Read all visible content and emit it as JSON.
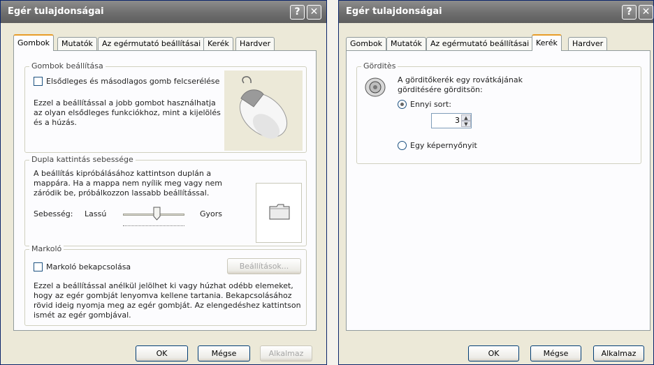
{
  "left": {
    "title": "Egér tulajdonságai",
    "help_glyph": "?",
    "close_glyph": "✕",
    "tabs": [
      "Gombok",
      "Mutatók",
      "Az egérmutató beállításai",
      "Kerék",
      "Hardver"
    ],
    "active_tab": "Gombok",
    "buttons_group": {
      "label": "Gombok beállítása",
      "swap_checkbox_label": "Elsődleges és másodlagos gomb felcserélése",
      "description": [
        "Ezzel a beállítással a jobb gombot használhatja",
        "az olyan elsődleges funkciókhoz, mint a kijelölés",
        "és a húzás."
      ]
    },
    "dblclick_group": {
      "label": "Dupla kattintás sebessége",
      "description": [
        "A beállítás kipróbálásához kattintson duplán a",
        "mappára. Ha a mappa nem nyílik meg vagy nem",
        "záródik be, próbálkozzon lassabb beállítással."
      ],
      "speed_label": "Sebesség:",
      "slow_label": "Lassú",
      "fast_label": "Gyors",
      "slider_value_fraction": 0.55
    },
    "clicklock_group": {
      "label": "Markoló",
      "checkbox_label": "Markoló bekapcsolása",
      "settings_button": "Beállítások...",
      "description": [
        "Ezzel a beállítással anélkül jelölhet ki vagy húzhat odébb elemeket,",
        "hogy az egér gombját lenyomva kellene tartania.  Bekapcsolásához",
        "rövid ideig nyomja meg az egér gombját.  Az elengedéshez kattintson",
        "ismét az egér gombjával."
      ]
    },
    "footer": {
      "ok": "OK",
      "cancel": "Mégse",
      "apply": "Alkalmaz"
    }
  },
  "right": {
    "title": "Egér tulajdonságai",
    "help_glyph": "?",
    "close_glyph": "✕",
    "tabs": [
      "Gombok",
      "Mutatók",
      "Az egérmutató beállításai",
      "Kerék",
      "Hardver"
    ],
    "active_tab": "Kerék",
    "scroll_group": {
      "label": "Görditès",
      "description": [
        "A görditőkerék egy rovátkájának",
        "görditésére görditsön:"
      ],
      "lines_radio_label": "Ennyi sort:",
      "lines_value": "3",
      "page_radio_label": "Egy képernyőnyit",
      "selected_option": "lines"
    },
    "footer": {
      "ok": "OK",
      "cancel": "Mégse",
      "apply": "Alkalmaz"
    }
  }
}
